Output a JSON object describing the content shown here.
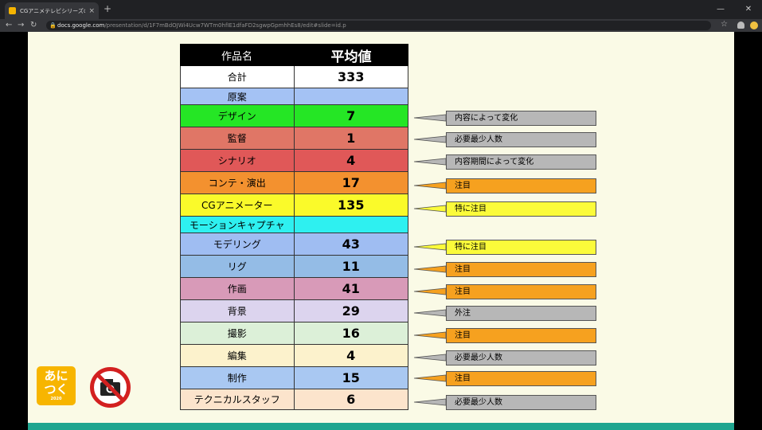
{
  "browser": {
    "tab_title": "CGアニメテレビシリーズの 人数と",
    "tab_close": "×",
    "new_tab": "+",
    "url_host": "docs.google.com",
    "url_path": "/presentation/d/1F7mBdOJWi4Ucw7WTm0hfIE1dfaFD2sgwpGpmhhEs8/edit#slide=id.p",
    "win_minimize": "—",
    "win_close": "✕"
  },
  "table": {
    "header": {
      "name": "作品名",
      "value": "平均値"
    },
    "rows": [
      {
        "name": "合計",
        "value": "333",
        "color": "#ffffff"
      },
      {
        "name": "原案",
        "value": "",
        "color": "#a4c2f4"
      },
      {
        "name": "デザイン",
        "value": "7",
        "color": "#25e625"
      },
      {
        "name": "監督",
        "value": "1",
        "color": "#e07666"
      },
      {
        "name": "シナリオ",
        "value": "4",
        "color": "#e05858"
      },
      {
        "name": "コンテ・演出",
        "value": "17",
        "color": "#f3912f"
      },
      {
        "name": "CGアニメーター",
        "value": "135",
        "color": "#fafa2a"
      },
      {
        "name": "モーションキャプチャ",
        "value": "",
        "color": "#2ef0f0"
      },
      {
        "name": "モデリング",
        "value": "43",
        "color": "#9fbdf2"
      },
      {
        "name": "リグ",
        "value": "11",
        "color": "#94bce6"
      },
      {
        "name": "作画",
        "value": "41",
        "color": "#d89ab8"
      },
      {
        "name": "背景",
        "value": "29",
        "color": "#dcd4ee"
      },
      {
        "name": "撮影",
        "value": "16",
        "color": "#dcf0d8"
      },
      {
        "name": "編集",
        "value": "4",
        "color": "#fcf2cc"
      },
      {
        "name": "制作",
        "value": "15",
        "color": "#a9c8f2"
      },
      {
        "name": "テクニカルスタッフ",
        "value": "6",
        "color": "#fce4cc"
      }
    ]
  },
  "notes": [
    {
      "text": "内容によって変化",
      "color": "#b7b7b7"
    },
    {
      "text": "必要最少人数",
      "color": "#b7b7b7"
    },
    {
      "text": "内容期間によって変化",
      "color": "#b7b7b7"
    },
    {
      "text": "注目",
      "color": "#f6a11f"
    },
    {
      "text": "特に注目",
      "color": "#fbfb3a"
    },
    {
      "text": "特に注目",
      "color": "#fbfb3a"
    },
    {
      "text": "注目",
      "color": "#f6a11f"
    },
    {
      "text": "注目",
      "color": "#f6a11f"
    },
    {
      "text": "外注",
      "color": "#b7b7b7"
    },
    {
      "text": "注目",
      "color": "#f6a11f"
    },
    {
      "text": "必要最少人数",
      "color": "#b7b7b7"
    },
    {
      "text": "注目",
      "color": "#f6a11f"
    },
    {
      "text": "必要最少人数",
      "color": "#b7b7b7"
    }
  ],
  "logos": {
    "anitsuku_line1": "あに",
    "anitsuku_line2": "つく",
    "anitsuku_year": "2020",
    "no_photo_icon": "no-camera-icon"
  }
}
